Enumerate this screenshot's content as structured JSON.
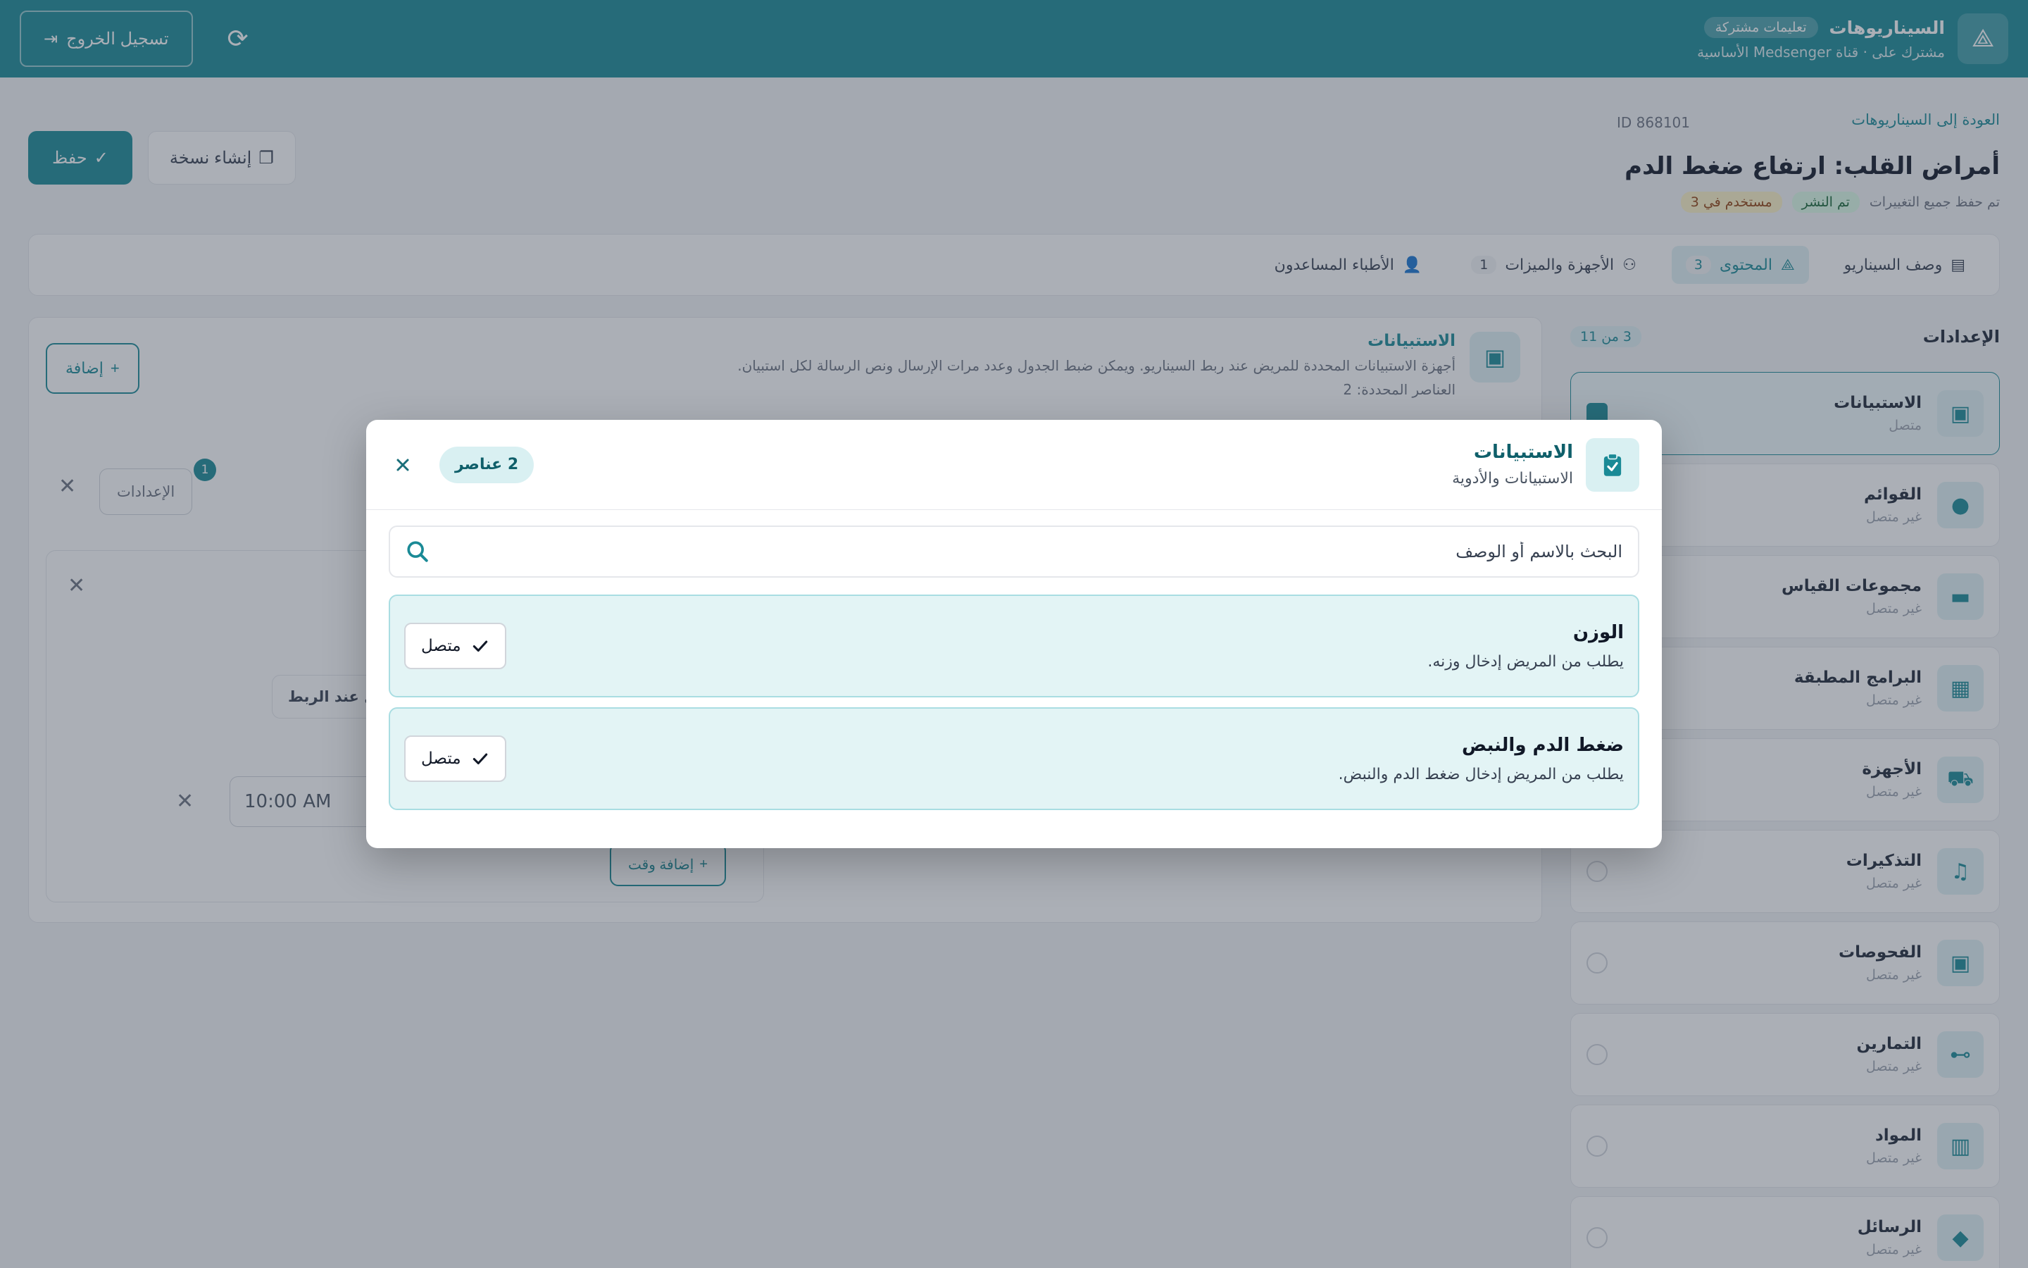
{
  "topbar": {
    "brand_title": "السيناريوهات",
    "brand_chip": "تعليمات مشتركة",
    "brand_sub": "مشترك على · قناة Medsenger الأساسية",
    "logout_label": "تسجيل الخروج"
  },
  "page": {
    "back_label": "العودة إلى السيناريوهات",
    "id_label": "ID 868101",
    "title": "أمراض القلب: ارتفاع ضغط الدم",
    "meta_saved": "تم حفظ جميع التغييرات",
    "meta_status": "تم النشر",
    "meta_usage": "مستخدم في 3",
    "copy_label": "إنشاء نسخة",
    "save_label": "حفظ"
  },
  "tabs": [
    {
      "label": "وصف السيناريو",
      "count": ""
    },
    {
      "label": "المحتوى",
      "count": "3"
    },
    {
      "label": "الأجهزة والميزات",
      "count": "1"
    },
    {
      "label": "الأطباء المساعدون",
      "count": ""
    }
  ],
  "sidebar": {
    "title": "الإعدادات",
    "count": "3 من 11",
    "items": [
      {
        "name": "الاستبيانات",
        "status": "متصل"
      },
      {
        "name": "القوائم",
        "status": "غير متصل"
      },
      {
        "name": "مجموعات القياس",
        "status": "غير متصل"
      },
      {
        "name": "البرامج المطبقة",
        "status": "غير متصل"
      },
      {
        "name": "الأجهزة",
        "status": "غير متصل"
      },
      {
        "name": "التذكيرات",
        "status": "غير متصل"
      },
      {
        "name": "الفحوصات",
        "status": "غير متصل"
      },
      {
        "name": "التمارين",
        "status": "غير متصل"
      },
      {
        "name": "المواد",
        "status": "غير متصل"
      },
      {
        "name": "الرسائل",
        "status": "غير متصل"
      }
    ]
  },
  "main": {
    "title": "الاستبيانات",
    "description": "أجهزة الاستبيانات المحددة للمريض عند ربط السيناريو. ويمكن ضبط الجدول وعدد مرات الإرسال ونص الرسالة لكل استبيان.",
    "selected_count": "العناصر المحددة: 2",
    "add_label": "إضافة",
    "config_label": "الإعدادات",
    "config_badge": "1",
    "send_label": "إرسال عند الربط",
    "time_value": "10:00 AM",
    "add_time_label": "إضافة وقت"
  },
  "modal": {
    "title": "الاستبيانات",
    "subtitle": "الاستبيانات والأدوية",
    "count_label": "2 عناصر",
    "search_placeholder": "البحث بالاسم أو الوصف",
    "items": [
      {
        "name": "الوزن",
        "description": "يطلب من المريض إدخال وزنه.",
        "action_label": "متصل"
      },
      {
        "name": "ضغط الدم والنبض",
        "description": "يطلب من المريض إدخال ضغط الدم والنبض.",
        "action_label": "متصل"
      }
    ]
  },
  "colors": {
    "brand": "#1a8a96",
    "modal_title": "#0f5f6a",
    "item_bg": "#e3f4f5",
    "item_border": "#a9dde2"
  }
}
